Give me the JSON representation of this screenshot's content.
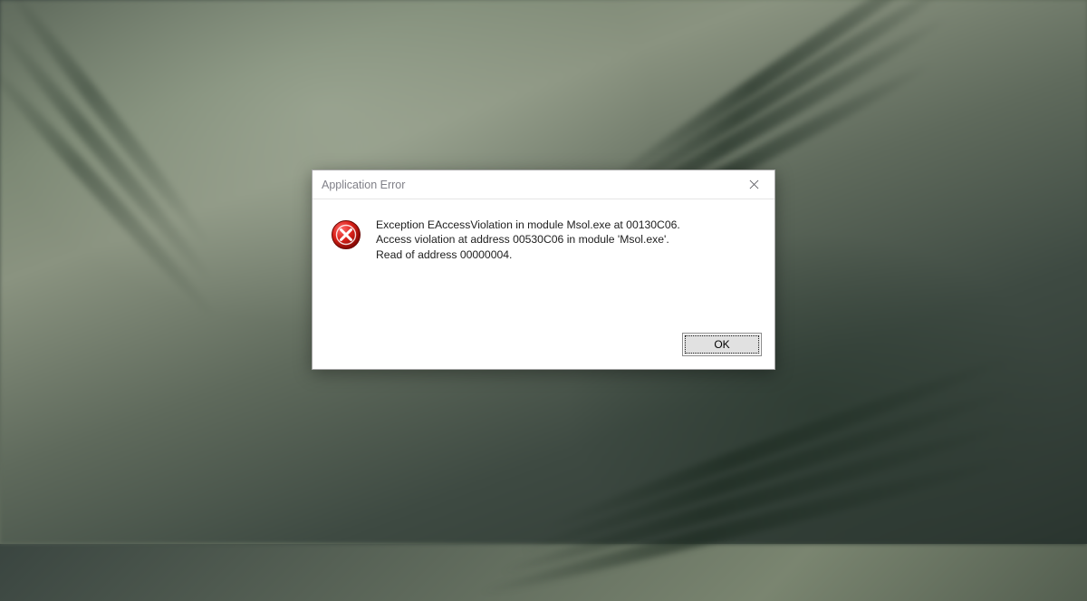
{
  "dialog": {
    "title": "Application Error",
    "message": "Exception EAccessViolation in module Msol.exe at 00130C06.\nAccess violation at address 00530C06 in module 'Msol.exe'.\nRead of address 00000004.",
    "buttons": {
      "ok": "OK"
    }
  }
}
